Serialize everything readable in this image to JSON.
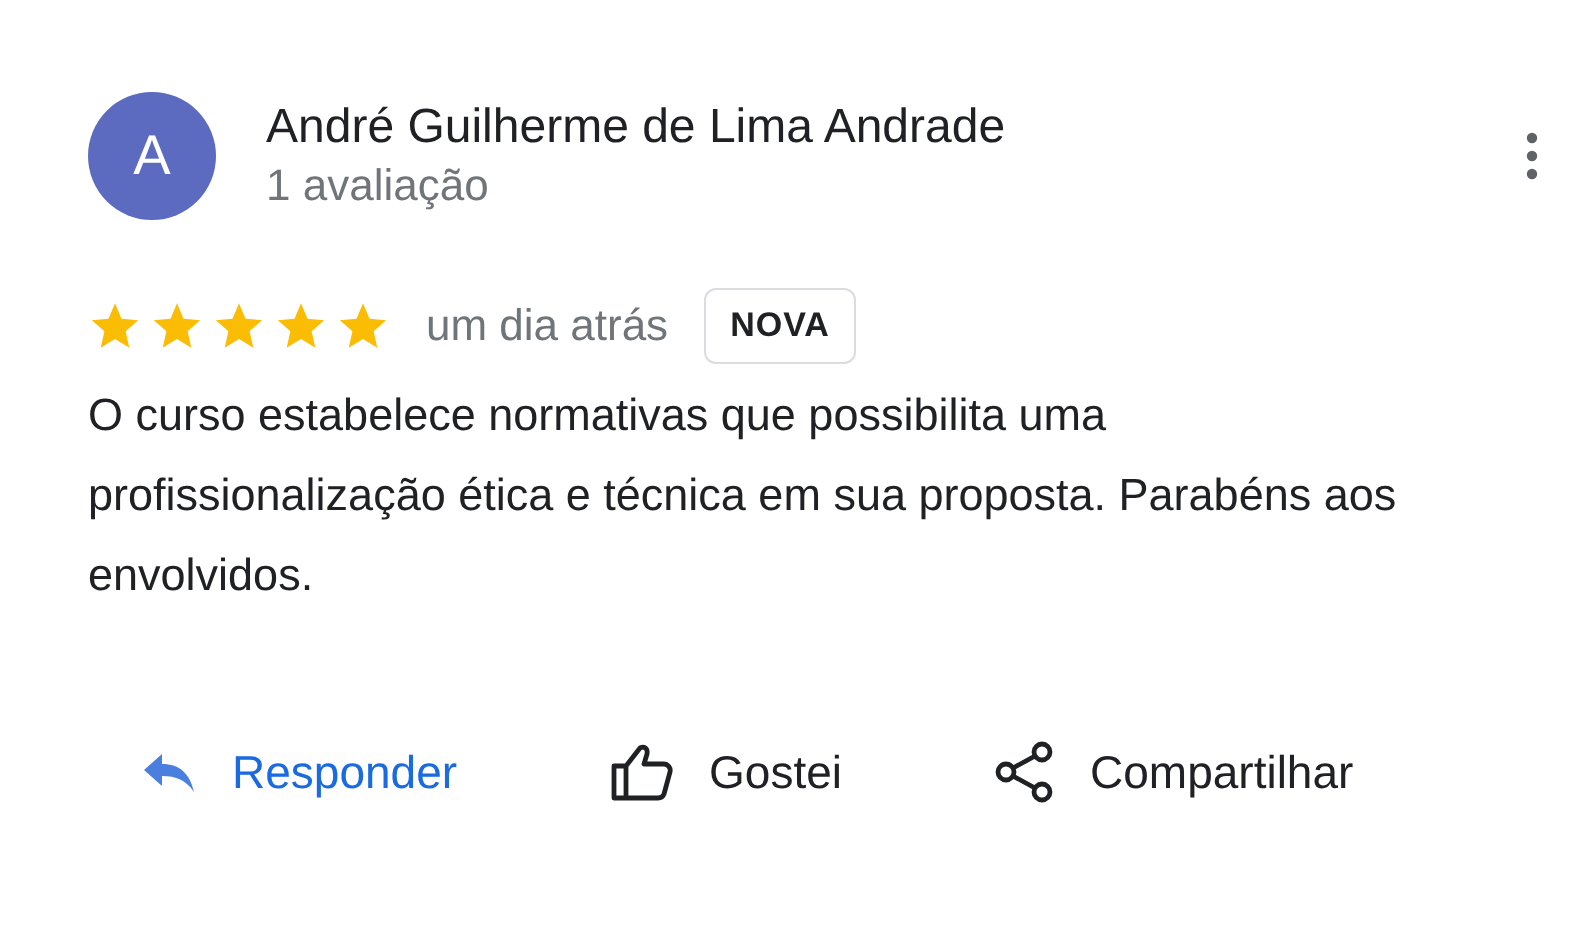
{
  "author": {
    "initial": "A",
    "name": "André Guilherme de Lima Andrade",
    "review_count": "1 avaliação"
  },
  "review": {
    "stars": 5,
    "time": "um dia atrás",
    "badge": "NOVA",
    "text": "O curso estabelece normativas que possibilita uma profissionalização ética e técnica em sua proposta. Parabéns aos envolvidos."
  },
  "actions": [
    {
      "kind": "reply",
      "label": "Responder"
    },
    {
      "kind": "like",
      "label": "Gostei"
    },
    {
      "kind": "share",
      "label": "Compartilhar"
    }
  ]
}
